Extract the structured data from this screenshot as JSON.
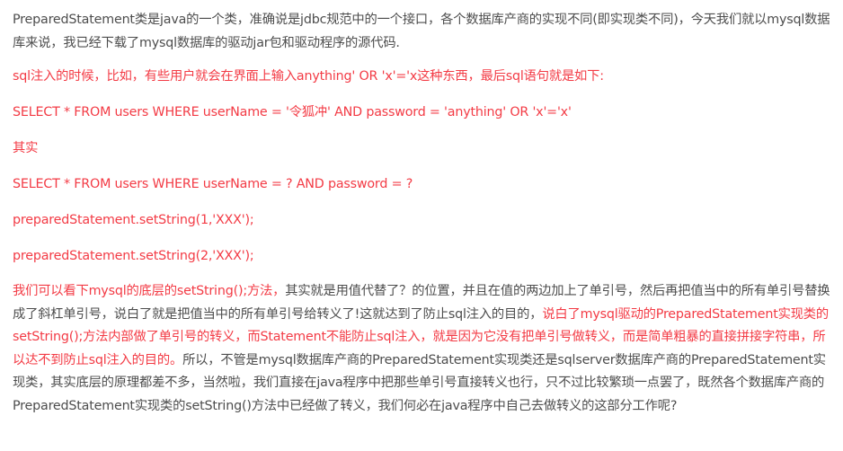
{
  "article": {
    "intro": "PreparedStatement类是java的一个类，准确说是jdbc规范中的一个接口，各个数据库产商的实现不同(即实现类不同)，今天我们就以mysql数据库来说，我已经下载了mysql数据库的驱动jar包和驱动程序的源代码.",
    "sql_injection_note": "sql注入的时候，比如，有些用户就会在界面上输入anything' OR 'x'='x这种东西，最后sql语句就是如下:",
    "sql_injected": "SELECT * FROM users WHERE  userName =  '令狐冲' AND password =  'anything' OR 'x'='x'",
    "actually": "其实",
    "sql_prepared": "SELECT * FROM users WHERE  userName =  ?  AND password =  ?",
    "set_string_1": "preparedStatement.setString(1,'XXX');",
    "set_string_2": "preparedStatement.setString(2,'XXX');",
    "explanation_red_1": "我们可以看下mysql的底层的setString();方法，",
    "explanation_grey_1": "其实就是用值代替了？的位置，并且在值的两边加上了单引号，然后再把值当中的所有单引号替换成了斜杠单引号，说白了就是把值当中的所有单引号给转义了!这就达到了防止sql注入的目的，",
    "explanation_red_2": "说白了mysql驱动的PreparedStatement实现类的setString();方法内部做了单引号的转义，而Statement不能防止sql注入，就是因为它没有把单引号做转义，而是简单粗暴的直接拼接字符串，所以达不到防止sql注入的目的。",
    "explanation_grey_2": "所以，不管是mysql数据库产商的PreparedStatement实现类还是sqlserver数据库产商的PreparedStatement实现类，其实底层的原理都差不多，当然啦，我们直接在java程序中把那些单引号直接转义也行，只不过比较繁琐一点罢了，既然各个数据库产商的PreparedStatement实现类的setString()方法中已经做了转义，我们何必在java程序中自己去做转义的这部分工作呢?"
  },
  "colors": {
    "text": "#4d4d4d",
    "highlight": "#f33b45",
    "background": "#ffffff"
  }
}
